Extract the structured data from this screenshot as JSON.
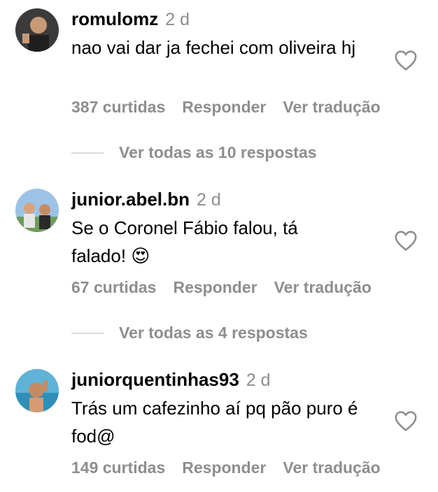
{
  "comments": [
    {
      "username": "romulomz",
      "time": "2 d",
      "text": "nao vai dar ja fechei com oliveira hj",
      "likes": "387 curtidas",
      "reply_label": "Responder",
      "translate_label": "Ver tradução",
      "view_replies": "Ver todas as 10 respostas"
    },
    {
      "username": "junior.abel.bn",
      "time": "2 d",
      "text": "Se o Coronel Fábio falou, tá falado! 😍",
      "likes": "67 curtidas",
      "reply_label": "Responder",
      "translate_label": "Ver tradução",
      "view_replies": "Ver todas as 4 respostas"
    },
    {
      "username": "juniorquentinhas93",
      "time": "2 d",
      "text": "Trás um cafezinho aí pq pão puro é fod@",
      "likes": "149 curtidas",
      "reply_label": "Responder",
      "translate_label": "Ver tradução"
    }
  ],
  "icons": {
    "like": "heart-outline-icon"
  },
  "colors": {
    "secondary_text": "#8e8e8e",
    "divider": "#dbdbdb"
  }
}
